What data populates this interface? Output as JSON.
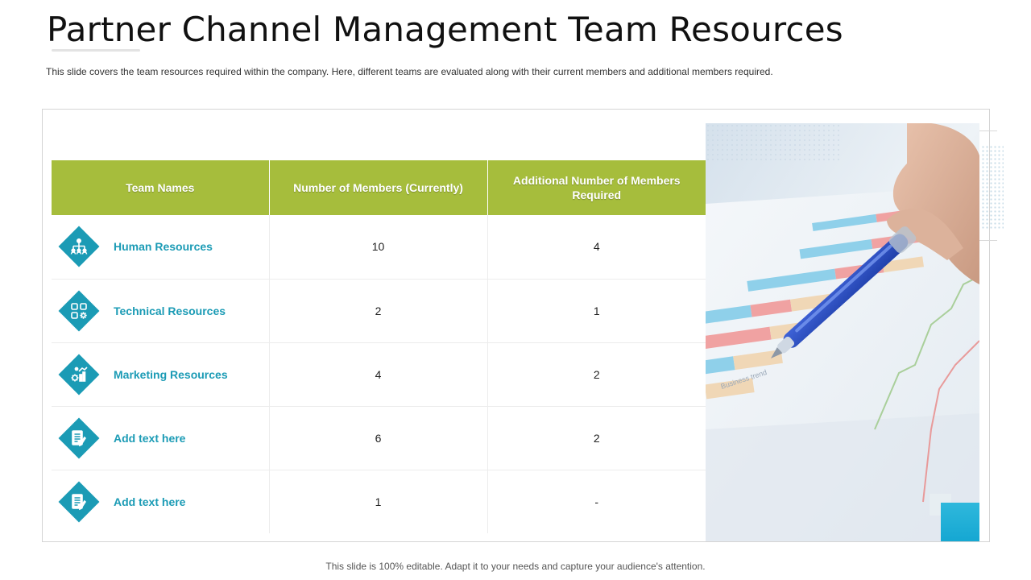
{
  "slide": {
    "title": "Partner Channel Management Team Resources",
    "subtitle": "This slide covers the team resources required within the company. Here, different  teams are evaluated  along with their current members and additional members required.",
    "footer": "This slide is 100% editable. Adapt it to your needs and capture your audience's attention."
  },
  "table": {
    "headers": [
      "Team Names",
      "Number of Members (Currently)",
      "Additional Number of Members Required"
    ],
    "rows": [
      {
        "name": "Human Resources",
        "icon": "org-chart-icon",
        "current": "10",
        "additional": "4"
      },
      {
        "name": "Technical Resources",
        "icon": "app-grid-gear-icon",
        "current": "2",
        "additional": "1"
      },
      {
        "name": "Marketing Resources",
        "icon": "marketing-gears-icon",
        "current": "4",
        "additional": "2"
      },
      {
        "name": "Add text here",
        "icon": "document-pencil-icon",
        "current": "6",
        "additional": "2"
      },
      {
        "name": "Add text here",
        "icon": "document-pencil-icon",
        "current": "1",
        "additional": "-"
      }
    ]
  },
  "colors": {
    "header_green": "#a6bd3c",
    "accent_teal": "#1b9bb5",
    "accent_blue": "#15a7d2"
  }
}
